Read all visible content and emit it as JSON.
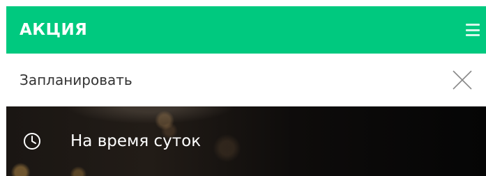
{
  "header": {
    "title": "АКЦИЯ",
    "menu_icon": "hamburger-menu-icon",
    "background_color": "#00c97f"
  },
  "subbar": {
    "title": "Запланировать",
    "close_icon": "close-icon"
  },
  "option": {
    "icon": "clock-icon",
    "label": "На время суток"
  }
}
